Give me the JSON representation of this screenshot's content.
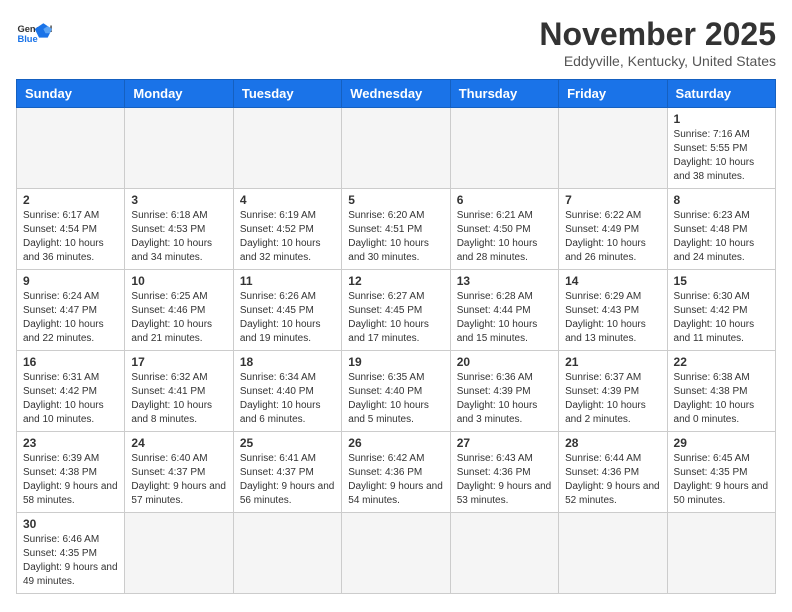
{
  "header": {
    "logo_general": "General",
    "logo_blue": "Blue",
    "title": "November 2025",
    "subtitle": "Eddyville, Kentucky, United States"
  },
  "weekdays": [
    "Sunday",
    "Monday",
    "Tuesday",
    "Wednesday",
    "Thursday",
    "Friday",
    "Saturday"
  ],
  "weeks": [
    [
      {
        "day": "",
        "empty": true
      },
      {
        "day": "",
        "empty": true
      },
      {
        "day": "",
        "empty": true
      },
      {
        "day": "",
        "empty": true
      },
      {
        "day": "",
        "empty": true
      },
      {
        "day": "",
        "empty": true
      },
      {
        "day": "1",
        "sunrise": "7:16 AM",
        "sunset": "5:55 PM",
        "daylight": "10 hours and 38 minutes."
      }
    ],
    [
      {
        "day": "2",
        "sunrise": "6:17 AM",
        "sunset": "4:54 PM",
        "daylight": "10 hours and 36 minutes."
      },
      {
        "day": "3",
        "sunrise": "6:18 AM",
        "sunset": "4:53 PM",
        "daylight": "10 hours and 34 minutes."
      },
      {
        "day": "4",
        "sunrise": "6:19 AM",
        "sunset": "4:52 PM",
        "daylight": "10 hours and 32 minutes."
      },
      {
        "day": "5",
        "sunrise": "6:20 AM",
        "sunset": "4:51 PM",
        "daylight": "10 hours and 30 minutes."
      },
      {
        "day": "6",
        "sunrise": "6:21 AM",
        "sunset": "4:50 PM",
        "daylight": "10 hours and 28 minutes."
      },
      {
        "day": "7",
        "sunrise": "6:22 AM",
        "sunset": "4:49 PM",
        "daylight": "10 hours and 26 minutes."
      },
      {
        "day": "8",
        "sunrise": "6:23 AM",
        "sunset": "4:48 PM",
        "daylight": "10 hours and 24 minutes."
      }
    ],
    [
      {
        "day": "9",
        "sunrise": "6:24 AM",
        "sunset": "4:47 PM",
        "daylight": "10 hours and 22 minutes."
      },
      {
        "day": "10",
        "sunrise": "6:25 AM",
        "sunset": "4:46 PM",
        "daylight": "10 hours and 21 minutes."
      },
      {
        "day": "11",
        "sunrise": "6:26 AM",
        "sunset": "4:45 PM",
        "daylight": "10 hours and 19 minutes."
      },
      {
        "day": "12",
        "sunrise": "6:27 AM",
        "sunset": "4:45 PM",
        "daylight": "10 hours and 17 minutes."
      },
      {
        "day": "13",
        "sunrise": "6:28 AM",
        "sunset": "4:44 PM",
        "daylight": "10 hours and 15 minutes."
      },
      {
        "day": "14",
        "sunrise": "6:29 AM",
        "sunset": "4:43 PM",
        "daylight": "10 hours and 13 minutes."
      },
      {
        "day": "15",
        "sunrise": "6:30 AM",
        "sunset": "4:42 PM",
        "daylight": "10 hours and 11 minutes."
      }
    ],
    [
      {
        "day": "16",
        "sunrise": "6:31 AM",
        "sunset": "4:42 PM",
        "daylight": "10 hours and 10 minutes."
      },
      {
        "day": "17",
        "sunrise": "6:32 AM",
        "sunset": "4:41 PM",
        "daylight": "10 hours and 8 minutes."
      },
      {
        "day": "18",
        "sunrise": "6:34 AM",
        "sunset": "4:40 PM",
        "daylight": "10 hours and 6 minutes."
      },
      {
        "day": "19",
        "sunrise": "6:35 AM",
        "sunset": "4:40 PM",
        "daylight": "10 hours and 5 minutes."
      },
      {
        "day": "20",
        "sunrise": "6:36 AM",
        "sunset": "4:39 PM",
        "daylight": "10 hours and 3 minutes."
      },
      {
        "day": "21",
        "sunrise": "6:37 AM",
        "sunset": "4:39 PM",
        "daylight": "10 hours and 2 minutes."
      },
      {
        "day": "22",
        "sunrise": "6:38 AM",
        "sunset": "4:38 PM",
        "daylight": "10 hours and 0 minutes."
      }
    ],
    [
      {
        "day": "23",
        "sunrise": "6:39 AM",
        "sunset": "4:38 PM",
        "daylight": "9 hours and 58 minutes."
      },
      {
        "day": "24",
        "sunrise": "6:40 AM",
        "sunset": "4:37 PM",
        "daylight": "9 hours and 57 minutes."
      },
      {
        "day": "25",
        "sunrise": "6:41 AM",
        "sunset": "4:37 PM",
        "daylight": "9 hours and 56 minutes."
      },
      {
        "day": "26",
        "sunrise": "6:42 AM",
        "sunset": "4:36 PM",
        "daylight": "9 hours and 54 minutes."
      },
      {
        "day": "27",
        "sunrise": "6:43 AM",
        "sunset": "4:36 PM",
        "daylight": "9 hours and 53 minutes."
      },
      {
        "day": "28",
        "sunrise": "6:44 AM",
        "sunset": "4:36 PM",
        "daylight": "9 hours and 52 minutes."
      },
      {
        "day": "29",
        "sunrise": "6:45 AM",
        "sunset": "4:35 PM",
        "daylight": "9 hours and 50 minutes."
      }
    ],
    [
      {
        "day": "30",
        "sunrise": "6:46 AM",
        "sunset": "4:35 PM",
        "daylight": "9 hours and 49 minutes."
      },
      {
        "day": "",
        "empty": true
      },
      {
        "day": "",
        "empty": true
      },
      {
        "day": "",
        "empty": true
      },
      {
        "day": "",
        "empty": true
      },
      {
        "day": "",
        "empty": true
      },
      {
        "day": "",
        "empty": true
      }
    ]
  ]
}
